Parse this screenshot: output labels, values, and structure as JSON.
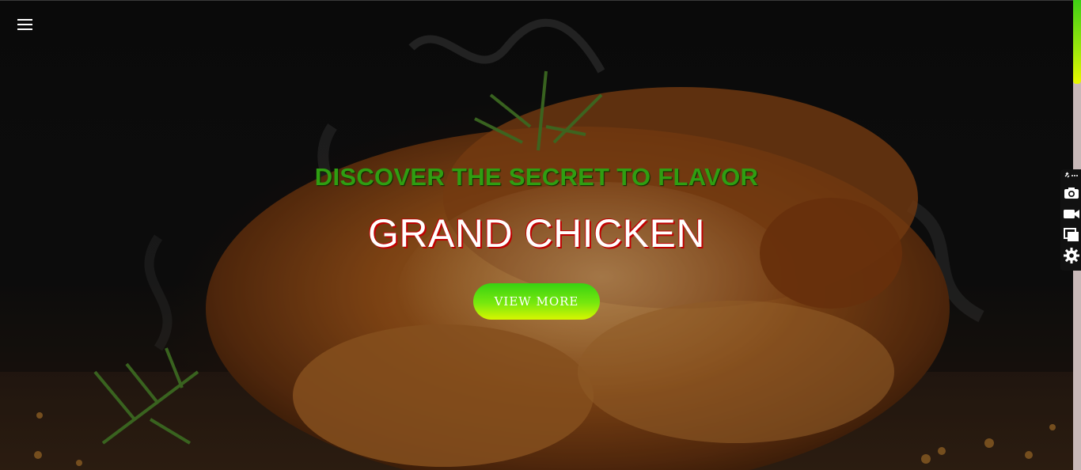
{
  "hero": {
    "tagline": "DISCOVER THE SECRET TO FLAVOR",
    "title": "GRAND CHICKEN",
    "cta_label": "VIEW MORE"
  },
  "nav": {
    "menu_icon": "hamburger-menu-icon"
  },
  "side_toolbar": {
    "items": [
      {
        "icon": "link-more-icon"
      },
      {
        "icon": "camera-icon"
      },
      {
        "icon": "video-camera-icon"
      },
      {
        "icon": "windows-stack-icon"
      },
      {
        "icon": "gear-icon"
      }
    ]
  },
  "colors": {
    "tagline": "#2f9e12",
    "title": "#ffffff",
    "title_shadow": "#c00000",
    "cta_gradient_top": "#38d212",
    "cta_gradient_bottom": "#d8f600",
    "scrollbar_track": "#c9b9b9"
  }
}
